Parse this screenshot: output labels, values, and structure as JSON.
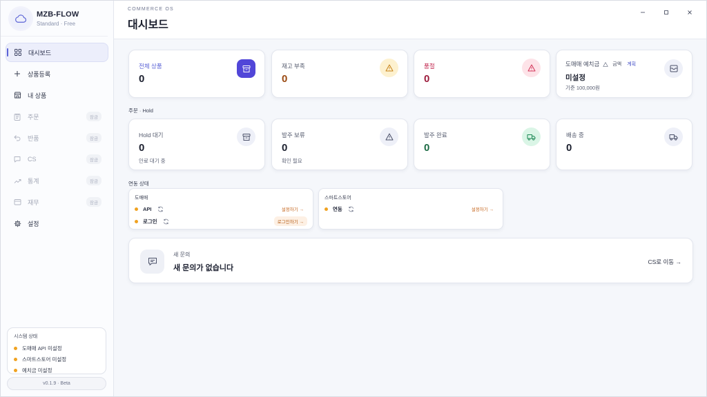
{
  "brand": {
    "name": "MZB-FLOW",
    "plan": "Standard · Free",
    "logo_icon": "cloud-icon"
  },
  "sidebar": {
    "items": [
      {
        "label": "대시보드",
        "icon": "grid-icon",
        "active": true,
        "badge": ""
      },
      {
        "label": "상품등록",
        "icon": "plus-icon",
        "active": false,
        "badge": ""
      },
      {
        "label": "내 상품",
        "icon": "shop-icon",
        "active": false,
        "badge": ""
      },
      {
        "label": "주문",
        "icon": "clipboard-icon",
        "active": false,
        "badge": "잠금"
      },
      {
        "label": "반품",
        "icon": "undo-icon",
        "active": false,
        "badge": "잠금"
      },
      {
        "label": "CS",
        "icon": "chat-icon",
        "active": false,
        "badge": "잠금"
      },
      {
        "label": "통계",
        "icon": "trend-icon",
        "active": false,
        "badge": "잠금"
      },
      {
        "label": "재무",
        "icon": "wallet-icon",
        "active": false,
        "badge": "잠금"
      },
      {
        "label": "설정",
        "icon": "gear-icon",
        "active": false,
        "badge": ""
      }
    ]
  },
  "system_status": {
    "title": "시스템 상태",
    "items": [
      "도매매 API 미설정",
      "스마트스토어 미설정",
      "예치금 미설정"
    ]
  },
  "version": "v0.1.9 · Beta",
  "header": {
    "eyebrow": "COMMERCE OS",
    "title": "대시보드"
  },
  "stats_top": [
    {
      "label": "전체 상품",
      "value": "0",
      "label_color": "#5b63d6",
      "value_color": "#1d2130",
      "icon": "archive-icon",
      "icon_bg": "#5146d8",
      "icon_color": "#ffffff"
    },
    {
      "label": "재고 부족",
      "value": "0",
      "label_color": "#555b6e",
      "value_color": "#9a4a12",
      "icon": "warning-icon",
      "icon_bg": "#fdf1cf",
      "icon_color": "#c7821a"
    },
    {
      "label": "품절",
      "value": "0",
      "label_color": "#c0264e",
      "value_color": "#9c1c3c",
      "icon": "warning-icon",
      "icon_bg": "#fde3e8",
      "icon_color": "#d23357"
    }
  ],
  "deposit": {
    "label": "도매매 예치금",
    "link_amount": "금액",
    "link_plan": "계획",
    "value": "미설정",
    "sub": "기준 100,000원",
    "icon": "inbox-icon"
  },
  "orders_section": "주문 · Hold",
  "stats_orders": [
    {
      "label": "Hold 대기",
      "value": "0",
      "sub": "안료 대기 중",
      "value_color": "#1d2130",
      "icon": "archive-icon",
      "icon_bg": "#eef0f8",
      "icon_color": "#4a5068"
    },
    {
      "label": "발주 보류",
      "value": "0",
      "sub": "확인 필요",
      "value_color": "#1d2130",
      "icon": "warning-icon",
      "icon_bg": "#eef0f8",
      "icon_color": "#4a5068"
    },
    {
      "label": "발주 완료",
      "value": "0",
      "sub": "",
      "value_color": "#1c6b44",
      "icon": "truck-icon",
      "icon_bg": "#daf5e6",
      "icon_color": "#1e8a55"
    },
    {
      "label": "배송 중",
      "value": "0",
      "sub": "",
      "value_color": "#1d2130",
      "icon": "truck-icon",
      "icon_bg": "#eef0f8",
      "icon_color": "#4a5068"
    }
  ],
  "link_section": "연동 상태",
  "link_cards": [
    {
      "title": "도매매",
      "rows": [
        {
          "name": "API",
          "action": "설정하기 →",
          "boxed": false
        },
        {
          "name": "로그인",
          "action": "로그인하기 →",
          "boxed": true
        }
      ]
    },
    {
      "title": "스마트스토어",
      "rows": [
        {
          "name": "연동",
          "action": "설정하기 →",
          "boxed": false
        }
      ]
    }
  ],
  "inquiry": {
    "label": "새 문의",
    "title": "새 문의가 없습니다",
    "link": "CS로 이동 →",
    "icon": "message-icon"
  },
  "window": {
    "minimize": "–",
    "maximize": "□",
    "close": "×"
  }
}
